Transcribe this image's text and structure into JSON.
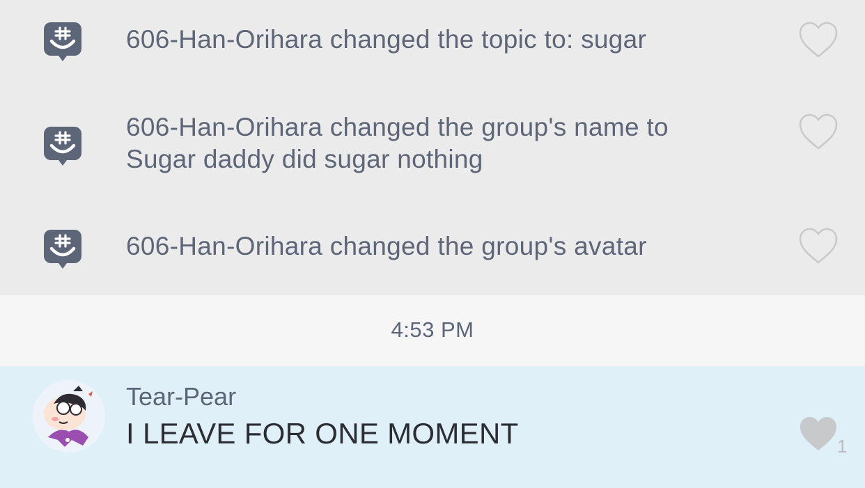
{
  "colors": {
    "system_background": "#ebebeb",
    "system_text": "#5d6578",
    "timestamp_background": "#f6f6f7",
    "message_background": "#dff0f9",
    "message_text": "#2b2d33",
    "heart_outline": "#c9c9cb",
    "heart_filled": "#c8c9cb",
    "icon_fill": "#5d6578"
  },
  "system_messages": [
    {
      "text": "606-Han-Orihara changed the topic to: sugar",
      "icon": "groupme-hashtag-icon",
      "like": "heart-outline-icon"
    },
    {
      "text": "606-Han-Orihara changed the group's name to Sugar daddy did sugar nothing",
      "icon": "groupme-hashtag-icon",
      "like": "heart-outline-icon"
    },
    {
      "text": "606-Han-Orihara changed the group's avatar",
      "icon": "groupme-hashtag-icon",
      "like": "heart-outline-icon"
    }
  ],
  "timestamp": "4:53 PM",
  "message": {
    "sender": "Tear-Pear",
    "text": "I LEAVE FOR ONE MOMENT",
    "avatar": "cartoon-avatar",
    "like_icon": "heart-filled-icon",
    "like_count": "1"
  }
}
